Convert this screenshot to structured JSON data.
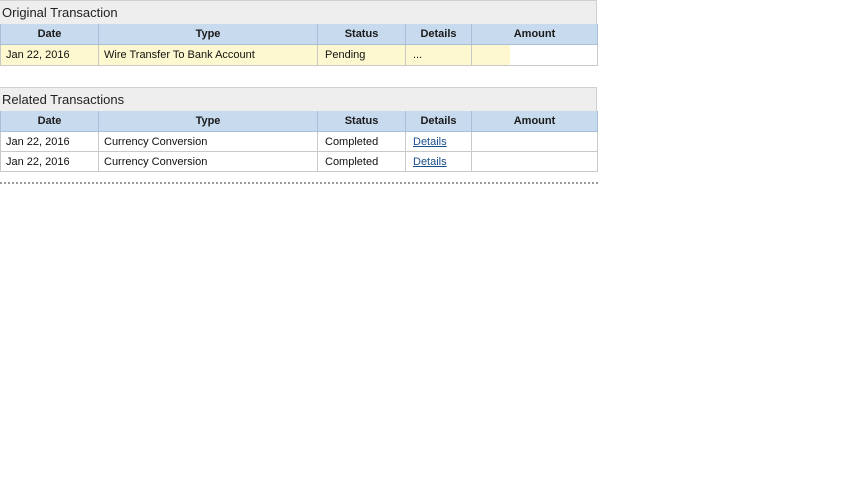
{
  "original": {
    "title": "Original Transaction",
    "columns": [
      "Date",
      "Type",
      "Status",
      "Details",
      "Amount"
    ],
    "rows": [
      {
        "date": "Jan 22, 2016",
        "type": "Wire Transfer To Bank Account",
        "status": "Pending",
        "details": "...",
        "amount": ""
      }
    ]
  },
  "related": {
    "title": "Related Transactions",
    "columns": [
      "Date",
      "Type",
      "Status",
      "Details",
      "Amount"
    ],
    "rows": [
      {
        "date": "Jan 22, 2016",
        "type": "Currency Conversion",
        "status": "Completed",
        "details": "Details",
        "amount": ""
      },
      {
        "date": "Jan 22, 2016",
        "type": "Currency Conversion",
        "status": "Completed",
        "details": "Details",
        "amount": ""
      }
    ]
  },
  "colors": {
    "header_bg": "#c8daee",
    "highlight_row": "#fdf8cf",
    "link": "#1a4d8c",
    "section_title_bg": "#eeeeee"
  }
}
